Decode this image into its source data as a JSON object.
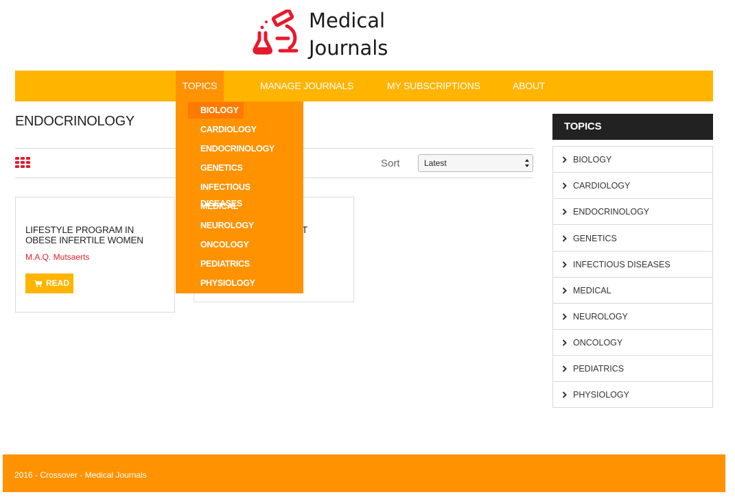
{
  "brand": {
    "line1": "Medical",
    "line2": "Journals",
    "icon": "microscope-flask-icon",
    "icon_color": "#E8192C"
  },
  "nav": {
    "items": [
      {
        "label": "TOPICS"
      },
      {
        "label": "MANAGE JOURNALS"
      },
      {
        "label": "MY SUBSCRIPTIONS"
      },
      {
        "label": "ABOUT"
      }
    ],
    "bar_color": "#FFB400",
    "active_color": "#FF9200"
  },
  "topics_dropdown": {
    "items": [
      "BIOLOGY",
      "CARDIOLOGY",
      "ENDOCRINOLOGY",
      "GENETICS",
      "INFECTIOUS DISEASES",
      "MEDICAL",
      "NEUROLOGY",
      "ONCOLOGY",
      "PEDIATRICS",
      "PHYSIOLOGY"
    ],
    "highlighted": "BIOLOGY"
  },
  "page": {
    "title": "ENDOCRINOLOGY"
  },
  "toolbar": {
    "view_icon": "grid-view-icon",
    "sort_label": "Sort",
    "sort_value": "Latest"
  },
  "journals": [
    {
      "title": "LIFESTYLE PROGRAM IN OBESE INFERTILE WOMEN",
      "author": "M.A.Q. Mutsaerts",
      "button": "READ"
    },
    {
      "title": "ST"
    }
  ],
  "sidebar": {
    "heading": "TOPICS",
    "items": [
      "BIOLOGY",
      "CARDIOLOGY",
      "ENDOCRINOLOGY",
      "GENETICS",
      "INFECTIOUS DISEASES",
      "MEDICAL",
      "NEUROLOGY",
      "ONCOLOGY",
      "PEDIATRICS",
      "PHYSIOLOGY"
    ]
  },
  "footer": {
    "text": "2016 - Crossover - Medical Journals"
  }
}
